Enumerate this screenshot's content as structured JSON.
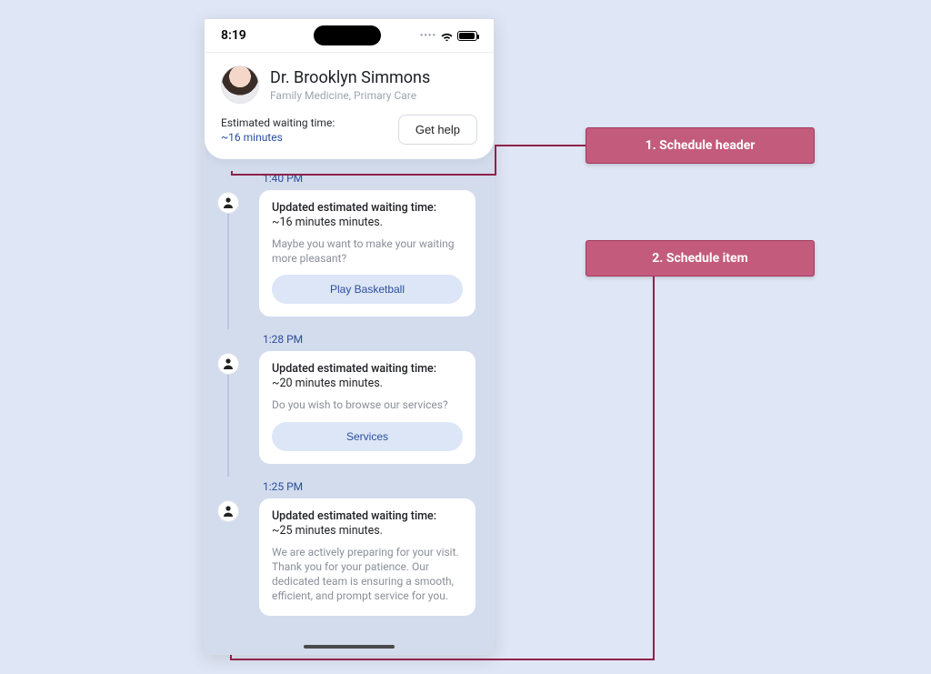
{
  "status": {
    "time": "8:19"
  },
  "header": {
    "doctor_name": "Dr. Brooklyn Simmons",
    "specialty": "Family Medicine, Primary Care",
    "wait_label": "Estimated waiting time:",
    "wait_value": "~16 minutes",
    "help_label": "Get help"
  },
  "timeline": [
    {
      "time": "1:40 PM",
      "title": "Updated estimated waiting time:",
      "subtitle": "~16 minutes minutes.",
      "body": "Maybe you want to make your waiting more pleasant?",
      "action": "Play Basketball"
    },
    {
      "time": "1:28 PM",
      "title": "Updated estimated waiting time:",
      "subtitle": "~20 minutes minutes.",
      "body": "Do you wish to browse our services?",
      "action": "Services"
    },
    {
      "time": "1:25 PM",
      "title": "Updated estimated waiting time:",
      "subtitle": "~25 minutes minutes.",
      "body": "We are actively preparing for your visit. Thank you for your patience. Our dedicated team is ensuring a smooth, efficient, and prompt service for you.",
      "action": null
    }
  ],
  "callouts": {
    "c1": "1. Schedule header",
    "c2": "2. Schedule item"
  }
}
